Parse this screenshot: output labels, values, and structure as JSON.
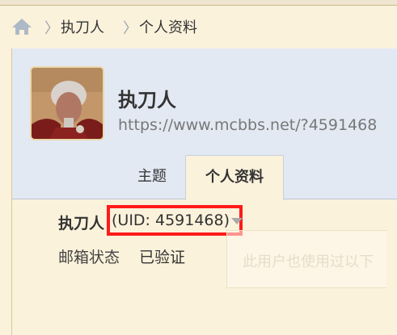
{
  "breadcrumb": {
    "separator": "〉",
    "items": [
      "执刀人",
      "个人资料"
    ]
  },
  "profile": {
    "username": "执刀人",
    "homepage": "https://www.mcbbs.net/?4591468"
  },
  "tabs": [
    {
      "label": "主题"
    },
    {
      "label": "个人资料"
    }
  ],
  "info": {
    "name": "执刀人",
    "uid": "(UID: 4591468)",
    "email_label": "邮箱状态",
    "email_value": "已验证"
  },
  "tooltip": {
    "text": "此用户也使用过以下"
  },
  "colors": {
    "background": "#fbf2db",
    "header": "#e3e9f3",
    "highlight": "#ff1a1a"
  }
}
